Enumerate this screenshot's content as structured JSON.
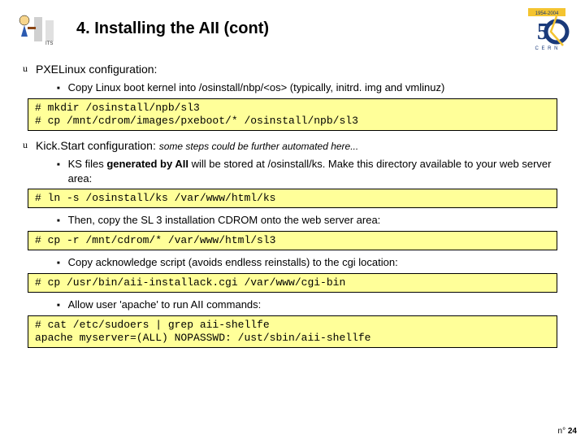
{
  "title": "4. Installing the AII (cont)",
  "s1": {
    "heading": "PXELinux configuration:",
    "b1": "Copy Linux boot kernel into /osinstall/nbp/<os> (typically, initrd. img and vmlinuz)",
    "code1": "# mkdir /osinstall/npb/sl3\n# cp /mnt/cdrom/images/pxeboot/* /osinstall/npb/sl3"
  },
  "s2": {
    "heading": "Kick.Start configuration: ",
    "headingNote": "some steps could be further automated here...",
    "b1a": "KS files ",
    "b1b": "generated by AII",
    "b1c": " will be stored at /osinstall/ks. Make this directory available to your web server area:",
    "code1": "# ln -s /osinstall/ks /var/www/html/ks",
    "b2": "Then, copy the SL 3 installation CDROM onto the web server area:",
    "code2": "# cp -r /mnt/cdrom/* /var/www/html/sl3",
    "b3": "Copy acknowledge script (avoids endless reinstalls) to the cgi location:",
    "code3": "# cp /usr/bin/aii-installack.cgi /var/www/cgi-bin",
    "b4": "Allow user 'apache' to run AII commands:",
    "code4": "# cat /etc/sudoers | grep aii-shellfe\napache myserver=(ALL) NOPASSWD: /ust/sbin/aii-shellfe"
  },
  "footer": {
    "pre": "n°",
    "num": "24"
  }
}
